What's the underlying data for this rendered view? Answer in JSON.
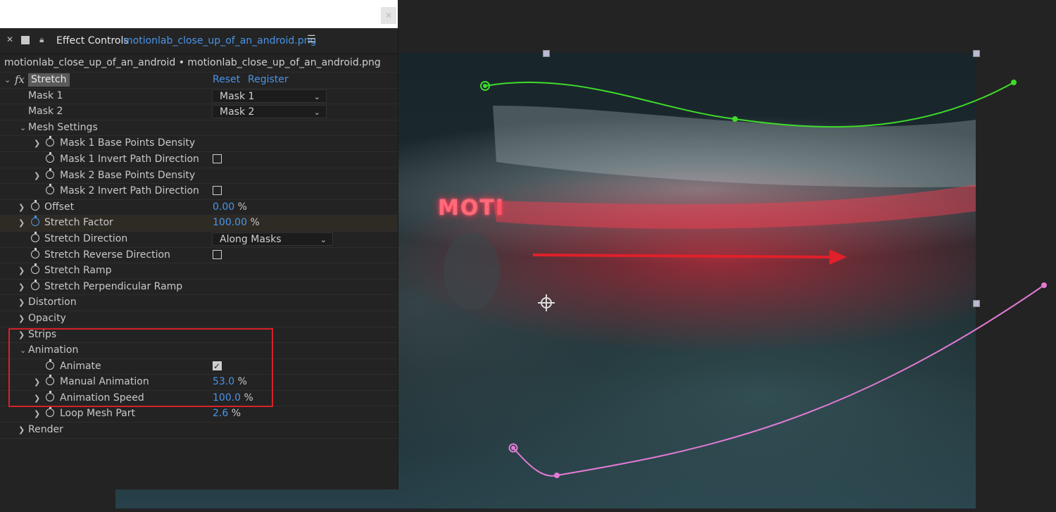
{
  "panel": {
    "title": "Effect Controls",
    "file_link": "motionlab_close_up_of_an_android.png",
    "menu_icon": "hamburger-icon",
    "breadcrumb": "motionlab_close_up_of_an_android • motionlab_close_up_of_an_android.png"
  },
  "effect": {
    "badge": "fx",
    "name": "Stretch",
    "reset_label": "Reset",
    "register_label": "Register"
  },
  "params": {
    "mask1": {
      "label": "Mask 1",
      "value": "Mask 1"
    },
    "mask2": {
      "label": "Mask 2",
      "value": "Mask 2"
    },
    "mesh_settings": "Mesh Settings",
    "mask1_density": "Mask 1 Base Points Density",
    "mask1_invert": {
      "label": "Mask 1 Invert Path Direction",
      "checked": false
    },
    "mask2_density": "Mask 2 Base Points Density",
    "mask2_invert": {
      "label": "Mask 2 Invert Path Direction",
      "checked": false
    },
    "offset": {
      "label": "Offset",
      "value": "0.00",
      "unit": "%"
    },
    "stretch_factor": {
      "label": "Stretch Factor",
      "value": "100.00",
      "unit": "%"
    },
    "stretch_direction": {
      "label": "Stretch Direction",
      "value": "Along Masks"
    },
    "stretch_reverse": {
      "label": "Stretch Reverse Direction",
      "checked": false
    },
    "stretch_ramp": "Stretch Ramp",
    "stretch_perp_ramp": "Stretch Perpendicular Ramp",
    "distortion": "Distortion",
    "opacity": "Opacity",
    "strips": "Strips",
    "animation": "Animation",
    "animate": {
      "label": "Animate",
      "checked": true
    },
    "manual_animation": {
      "label": "Manual Animation",
      "value": "53.0",
      "unit": "%"
    },
    "animation_speed": {
      "label": "Animation Speed",
      "value": "100.0",
      "unit": "%"
    },
    "loop_mesh_part": {
      "label": "Loop Mesh Part",
      "value": "2.6",
      "unit": "%"
    },
    "render": "Render"
  },
  "viewer": {
    "overlay_text": "MOTI",
    "colors": {
      "mask1_path": "#3fdc2a",
      "mask2_path": "#e27ad4",
      "arrow": "#e0202a",
      "accent": "#4a95e8",
      "highlight_box": "#d6222a"
    }
  }
}
